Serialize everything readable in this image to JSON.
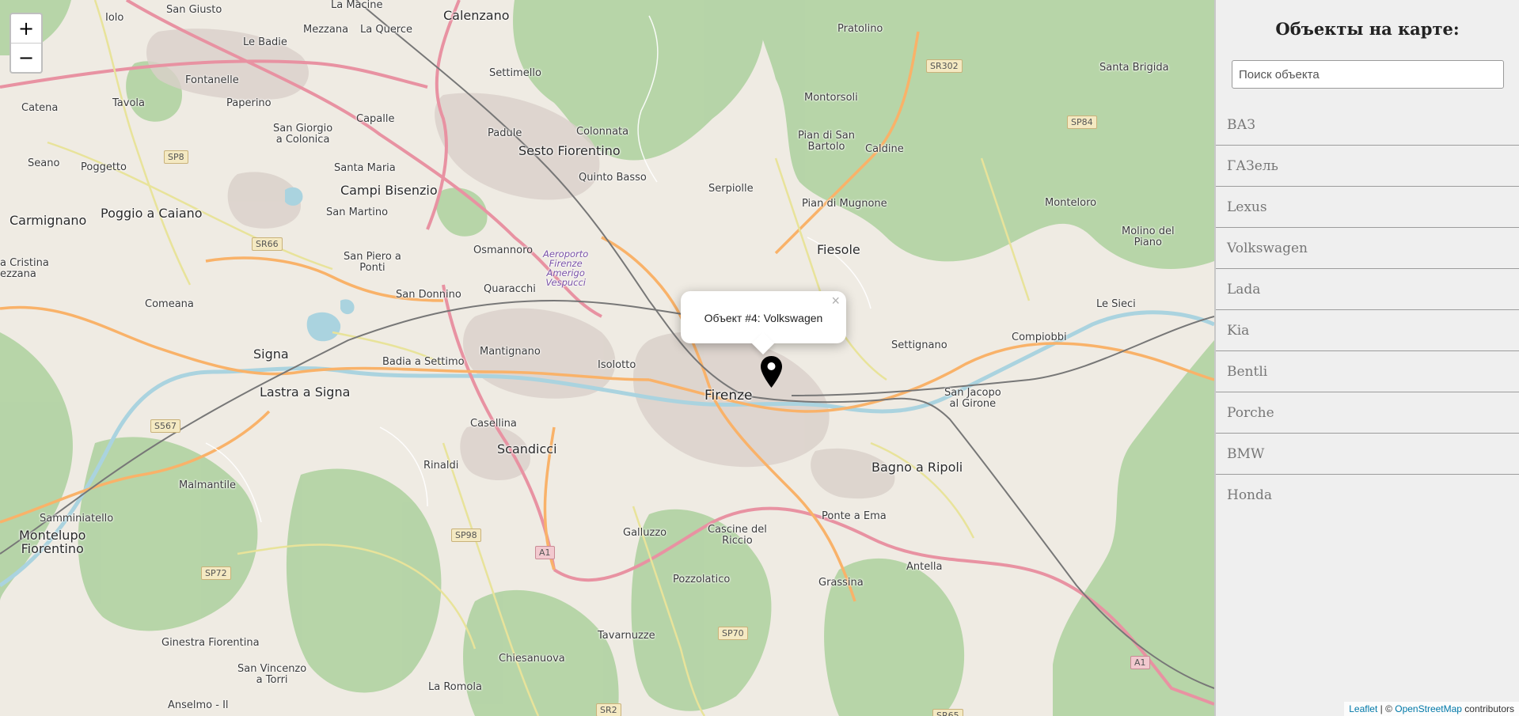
{
  "map": {
    "zoom_in_label": "+",
    "zoom_out_label": "−",
    "popup_text": "Объект #4: Volkswagen",
    "popup_close": "×",
    "attribution": {
      "leaflet": "Leaflet",
      "separator": " | © ",
      "osm": "OpenStreetMap",
      "suffix": " contributors"
    },
    "labels": {
      "iolo": "Iolo",
      "san_giusto": "San Giusto",
      "la_macine": "La Macine",
      "calenzano": "Calenzano",
      "le_badie": "Le Badie",
      "mezzana": "Mezzana",
      "la_querce": "La Querce",
      "fontanelle": "Fontanelle",
      "settimello": "Settimello",
      "pratolino": "Pratolino",
      "tavola": "Tavola",
      "paperino": "Paperino",
      "catena": "Catena",
      "capalle": "Capalle",
      "padule": "Padule",
      "colonnata": "Colonnata",
      "montorsoli": "Montorsoli",
      "santa_brigida": "Santa Brigida",
      "san_giorgio": "San Giorgio\na Colonica",
      "pian_di_san_bartolo": "Pian di San\nBartolo",
      "caldine": "Caldine",
      "sesto_fiorentino": "Sesto Fiorentino",
      "seano": "Seano",
      "poggetto": "Poggetto",
      "santa_maria": "Santa Maria",
      "quinto_basso": "Quinto Basso",
      "campi_bisenzio": "Campi Bisenzio",
      "serpiolle": "Serpiolle",
      "poggio_a_caiano": "Poggio a Caiano",
      "carmignano": "Carmignano",
      "san_martino": "San Martino",
      "pian_di_mugnone": "Pian di Mugnone",
      "monteloro": "Monteloro",
      "molino_del_piano": "Molino del\nPiano",
      "osmannoro": "Osmannoro",
      "fiesole": "Fiesole",
      "san_piero_a_ponti": "San Piero a\nPonti",
      "aeroporto": "Aeroporto\nFirenze\nAmerigo\nVespucci",
      "santa_cristina": "a Cristina\nezzana",
      "quaracchi": "Quaracchi",
      "san_donnino": "San Donnino",
      "comeana": "Comeana",
      "le_sieci": "Le Sieci",
      "compiobbi": "Compiobbi",
      "settignano": "Settignano",
      "mantignano": "Mantignano",
      "signa": "Signa",
      "badia_a_settimo": "Badia a Settimo",
      "isolotto": "Isolotto",
      "lastra_a_signa": "Lastra a Signa",
      "firenze": "Firenze",
      "san_jacopo": "San Jacopo\nal Girone",
      "casellina": "Casellina",
      "scandicci": "Scandicci",
      "rinaldi": "Rinaldi",
      "bagno_a_ripoli": "Bagno a Ripoli",
      "malmantile": "Malmantile",
      "samminiatello": "Samminiatello",
      "ponte_a_ema": "Ponte a Ema",
      "montelupo": "Montelupo\nFiorentino",
      "galluzzo": "Galluzzo",
      "cascine_del_riccio": "Cascine del\nRiccio",
      "antella": "Antella",
      "grassina": "Grassina",
      "pozzolatico": "Pozzolatico",
      "tavarnuzze": "Tavarnuzze",
      "ginestra_fiorentina": "Ginestra Fiorentina",
      "chiesanuova": "Chiesanuova",
      "san_vincenzo": "San Vincenzo\na Torri",
      "la_romola": "La Romola",
      "anselmo": "Anselmo - Il"
    },
    "shields": {
      "sp8": "SP8",
      "sr66": "SR66",
      "s567": "S567",
      "sr302": "SR302",
      "sp84": "SP84",
      "sp98": "SP98",
      "sp72": "SP72",
      "a1_left": "A1",
      "sp70": "SP70",
      "a1_right": "A1",
      "sr2": "SR2",
      "sr65": "SR65"
    },
    "colors": {
      "land": "#efebe3",
      "forest": "#add19e",
      "urban": "#d9d0c9",
      "motorway": "#e892a2",
      "primary": "#f9b269",
      "secondary": "#f6fabb",
      "water": "#aad3df",
      "rail": "#777777"
    }
  },
  "sidebar": {
    "title": "Объекты на карте:",
    "search_placeholder": "Поиск объекта",
    "items": [
      "ВАЗ",
      "ГАЗель",
      "Lexus",
      "Volkswagen",
      "Lada",
      "Kia",
      "Bentli",
      "Porche",
      "BMW",
      "Honda"
    ]
  }
}
